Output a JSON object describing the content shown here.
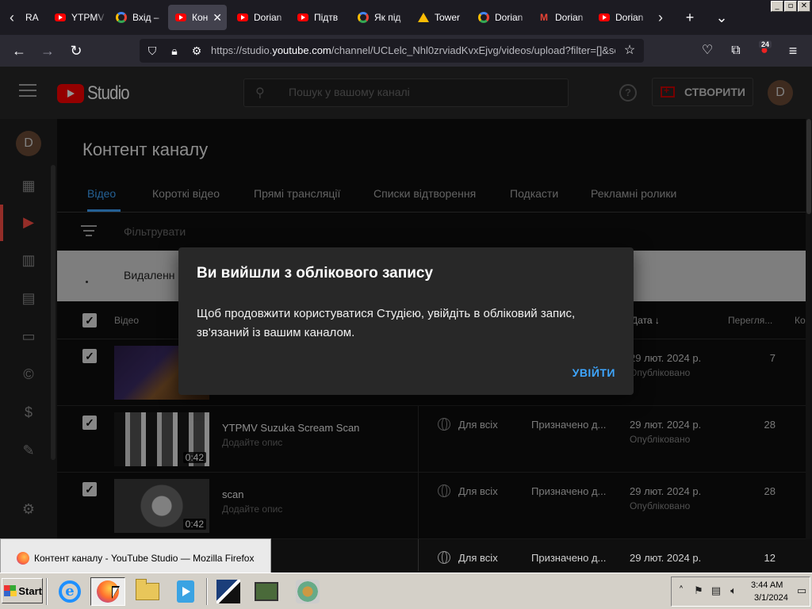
{
  "browser": {
    "window_controls": [
      "_",
      "▫",
      "✕"
    ],
    "tabs": [
      {
        "title": "RA",
        "icon": "none"
      },
      {
        "title": "YTPMV",
        "icon": "youtube-icon"
      },
      {
        "title": "Вхід –",
        "icon": "google-icon"
      },
      {
        "title": "Кон",
        "icon": "youtube-icon",
        "active": true
      },
      {
        "title": "Dorian",
        "icon": "youtube-icon"
      },
      {
        "title": "Підтв",
        "icon": "youtube-icon"
      },
      {
        "title": "Як під",
        "icon": "google-icon"
      },
      {
        "title": "Tower",
        "icon": "google-drive-icon"
      },
      {
        "title": "Dorian",
        "icon": "google-icon"
      },
      {
        "title": "Dorian",
        "icon": "gmail-icon"
      },
      {
        "title": "Dorian",
        "icon": "youtube-icon"
      }
    ],
    "url_prefix": "https://studio.",
    "url_domain": "youtube.com",
    "url_path": "/channel/UCLelc_Nhl0zrviadKvxEjvg/videos/upload?filter=[]&so",
    "extension_badge": "24"
  },
  "studio": {
    "logo_text": "Studio",
    "search_placeholder": "Пошук у вашому каналі",
    "help_label": "?",
    "create_label": "СТВОРИТИ",
    "avatar_letter": "D",
    "page_title": "Контент каналу",
    "tabs": [
      "Відео",
      "Короткі відео",
      "Прямі трансляції",
      "Списки відтворення",
      "Подкасти",
      "Рекламні ролики"
    ],
    "filter_placeholder": "Фільтрувати",
    "deleted_text": "Видаленн",
    "table_headers": {
      "video": "Відео",
      "date": "Дата ↓",
      "views": "Перегля...",
      "comments": "Ко"
    },
    "rows": [
      {
        "title": "",
        "desc": "",
        "duration": "",
        "visibility": "",
        "restrictions": "",
        "date": "29 лют. 2024 р.",
        "status": "Опубліковано",
        "views": "7"
      },
      {
        "title": "YTPMV Suzuka Scream Scan",
        "desc": "Додайте опис",
        "duration": "0:42",
        "visibility": "Для всіх",
        "restrictions": "Призначено д...",
        "date": "29 лют. 2024 р.",
        "status": "Опубліковано",
        "views": "28"
      },
      {
        "title": "scan",
        "desc": "Додайте опис",
        "duration": "0:42",
        "visibility": "Для всіх",
        "restrictions": "Призначено д...",
        "date": "29 лют. 2024 р.",
        "status": "Опубліковано",
        "views": "28"
      },
      {
        "title": "",
        "desc": "",
        "duration": "",
        "visibility": "Для всіх",
        "restrictions": "Призначено д...",
        "date": "29 лют. 2024 р.",
        "status": "",
        "views": "12"
      }
    ]
  },
  "dialog": {
    "title": "Ви вийшли з облікового запису",
    "body": "Щоб продовжити користуватися Студією, увійдіть в обліковий запис, зв'язаний із вашим каналом.",
    "signin_label": "УВІЙТИ"
  },
  "taskbar": {
    "start_label": "Start",
    "tooltip": "Контент каналу - YouTube Studio — Mozilla Firefox",
    "time": "3:44 AM",
    "date": "3/1/2024"
  }
}
